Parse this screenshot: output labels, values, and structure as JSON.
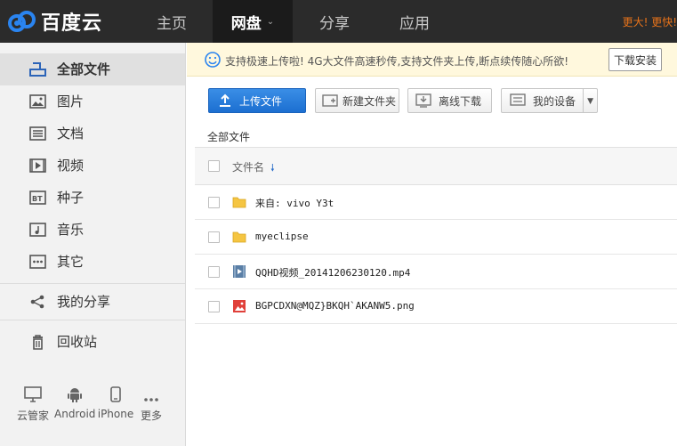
{
  "header": {
    "logo_text": "百度云",
    "nav": [
      {
        "label": "主页"
      },
      {
        "label": "网盘",
        "active": true
      },
      {
        "label": "分享"
      },
      {
        "label": "应用"
      }
    ],
    "promo": "更大! 更快!"
  },
  "sidebar": {
    "items": [
      {
        "label": "全部文件",
        "icon": "all-files-icon",
        "active": true
      },
      {
        "label": "图片",
        "icon": "image-icon"
      },
      {
        "label": "文档",
        "icon": "document-icon"
      },
      {
        "label": "视频",
        "icon": "video-icon"
      },
      {
        "label": "种子",
        "icon": "bt-icon"
      },
      {
        "label": "音乐",
        "icon": "music-icon"
      },
      {
        "label": "其它",
        "icon": "other-icon"
      },
      {
        "label": "我的分享",
        "icon": "share-icon"
      },
      {
        "label": "回收站",
        "icon": "trash-icon"
      }
    ],
    "devices": [
      {
        "label": "云管家",
        "icon": "monitor-icon"
      },
      {
        "label": "Android",
        "icon": "android-icon"
      },
      {
        "label": "iPhone",
        "icon": "iphone-icon"
      },
      {
        "label": "更多",
        "icon": "more-icon"
      }
    ]
  },
  "notice": {
    "text": "支持极速上传啦! 4G大文件高速秒传,支持文件夹上传,断点续传随心所欲!",
    "button": "下载安装"
  },
  "toolbar": {
    "upload": "上传文件",
    "new_folder": "新建文件夹",
    "offline": "离线下载",
    "devices": "我的设备"
  },
  "breadcrumb": "全部文件",
  "list": {
    "header": "文件名",
    "files": [
      {
        "name": "来自: vivo Y3t",
        "type": "folder"
      },
      {
        "name": "myeclipse",
        "type": "folder"
      },
      {
        "name": "QQHD视频_20141206230120.mp4",
        "type": "video"
      },
      {
        "name": "BGPCDXN@MQZ}BKQH`AKANW5.png",
        "type": "image"
      }
    ]
  },
  "colors": {
    "accent": "#1c6fd1",
    "topbar": "#2b2b2b",
    "promo": "#e8731a",
    "folder": "#f5c542"
  }
}
